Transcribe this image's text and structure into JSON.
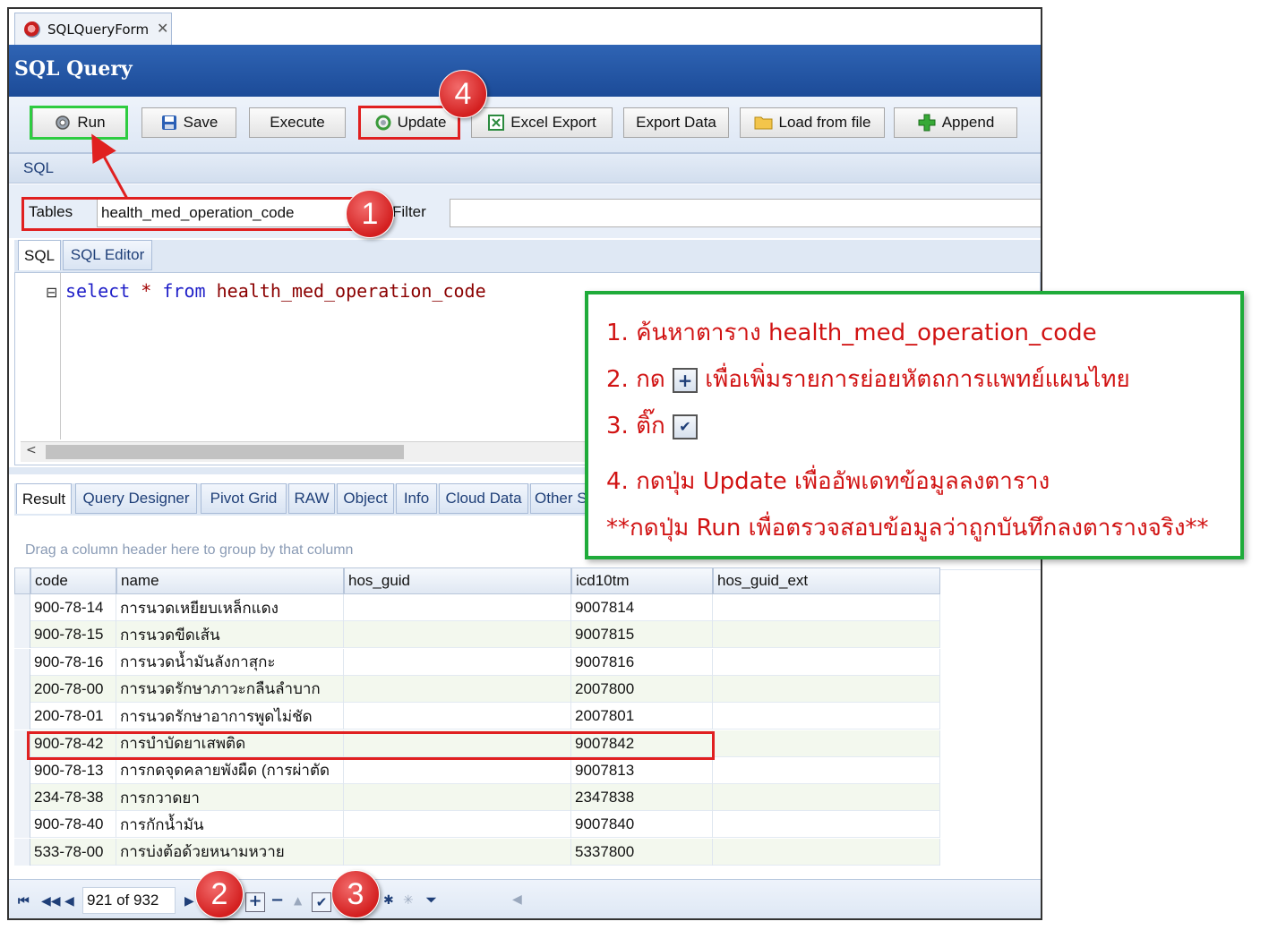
{
  "doc_tab": {
    "title": "SQLQueryForm",
    "close": "✕"
  },
  "window": {
    "title": "SQL Query"
  },
  "toolbar": {
    "run": "Run",
    "save": "Save",
    "execute": "Execute",
    "update": "Update",
    "excel_export": "Excel Export",
    "export_data": "Export Data",
    "load_from_file": "Load from file",
    "append": "Append"
  },
  "sql_section": {
    "label": "SQL"
  },
  "filter": {
    "tables_label": "Tables",
    "tables_value": "health_med_operation_code",
    "filter_label": "Filter",
    "filter_value": ""
  },
  "editor_tabs": [
    "SQL",
    "SQL Editor"
  ],
  "editor": {
    "kw_select": "select",
    "star": "*",
    "kw_from": "from",
    "table": "health_med_operation_code",
    "fold": "⊟"
  },
  "result_tabs": [
    "Result",
    "Query Designer",
    "Pivot Grid",
    "RAW",
    "Object",
    "Info",
    "Cloud Data",
    "Other S"
  ],
  "grid": {
    "group_hint": "Drag a column header here to group by that column",
    "columns": [
      "code",
      "name",
      "hos_guid",
      "icd10tm",
      "hos_guid_ext"
    ],
    "rows": [
      [
        "900-78-14",
        "การนวดเหยียบเหล็กแดง",
        "",
        "9007814",
        ""
      ],
      [
        "900-78-15",
        "การนวดขีดเส้น",
        "",
        "9007815",
        ""
      ],
      [
        "900-78-16",
        "การนวดน้ำมันลังกาสุกะ",
        "",
        "9007816",
        ""
      ],
      [
        "200-78-00",
        "การนวดรักษาภาวะกลืนลำบาก",
        "",
        "2007800",
        ""
      ],
      [
        "200-78-01",
        "การนวดรักษาอาการพูดไม่ชัด",
        "",
        "2007801",
        ""
      ],
      [
        "900-78-42",
        "การบำบัดยาเสพติด",
        "",
        "9007842",
        ""
      ],
      [
        "900-78-13",
        "การกดจุดคลายพังผืด (การผ่าตัด",
        "",
        "9007813",
        ""
      ],
      [
        "234-78-38",
        "การกวาดยา",
        "",
        "2347838",
        ""
      ],
      [
        "900-78-40",
        "การกักน้ำมัน",
        "",
        "9007840",
        ""
      ],
      [
        "533-78-00",
        "การบ่งต้อด้วยหนามหวาย",
        "",
        "5337800",
        ""
      ]
    ],
    "highlighted_row": 5
  },
  "navigator": {
    "position": "921 of 932"
  },
  "badges": {
    "b1": "1",
    "b2": "2",
    "b3": "3",
    "b4": "4"
  },
  "note": {
    "line1": "1. ค้นหาตาราง health_med_operation_code",
    "line2_pre": "2. กด",
    "line2_post": "เพื่อเพิ่มรายการย่อยหัตถการแพทย์แผนไทย",
    "line3_pre": "3. ติ๊ก",
    "line4": "4. กดปุ่ม Update เพื่ออัพเดทข้อมูลลงตาราง",
    "line5": "**กดปุ่ม Run เพื่อตรวจสอบข้อมูลว่าถูกบันทึกลงตารางจริง**"
  },
  "colors": {
    "title_blue": "#1f4f9c",
    "callout_red": "#e02020",
    "callout_green": "#1fab3a",
    "note_text": "#d11313"
  }
}
